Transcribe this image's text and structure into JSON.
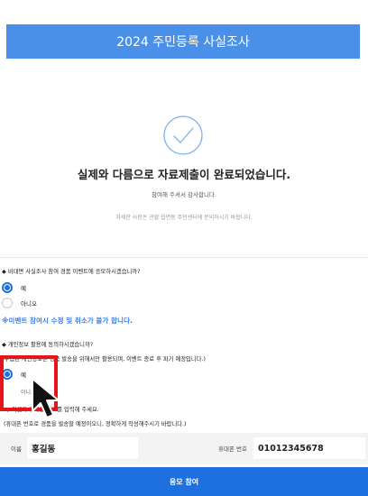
{
  "header": {
    "title": "2024 주민등록 사실조사"
  },
  "completion": {
    "title": "실제와 다름으로 자료제출이 완료되었습니다.",
    "thanks": "참여해 주셔서 감사합니다.",
    "detail": "자세한 사항은 관할 읍면동 주민센터에 문의하시기 바랍니다."
  },
  "event_question": {
    "question": "◆ 비대면 사실조사 참여 경품 이벤트에 응모하시겠습니까?",
    "options": [
      {
        "label": "예",
        "selected": true
      },
      {
        "label": "아니오",
        "selected": false
      }
    ],
    "notice": "※이벤트 참여시 수정 및 취소가 불가 합니다."
  },
  "privacy_question": {
    "question": "◆ 개인정보 활용에 동의하시겠습니까?",
    "sub": "(수집된 개인정보는 경품 발송을 위해서만 활용되며, 이벤트 종료 후 파기 예정입니다.)",
    "options": [
      {
        "label": "예",
        "selected": true
      },
      {
        "label": "아니오",
        "selected": false
      }
    ]
  },
  "contact": {
    "instruction": "◆ 이름과 휴대폰 번호를 입력해 주세요.",
    "sub": "(휴대폰 번호로 경품을 발송할 예정이오니, 정확하게 작성해주시기 바랍니다.)",
    "name_label": "이름",
    "name_value": "홍길동",
    "phone_label": "휴대폰 번호",
    "phone_value": "01012345678"
  },
  "submit_label": "응모 참여",
  "colors": {
    "header": "#4a90e8",
    "accent": "#1e6fe0",
    "highlight": "#e5161b"
  }
}
